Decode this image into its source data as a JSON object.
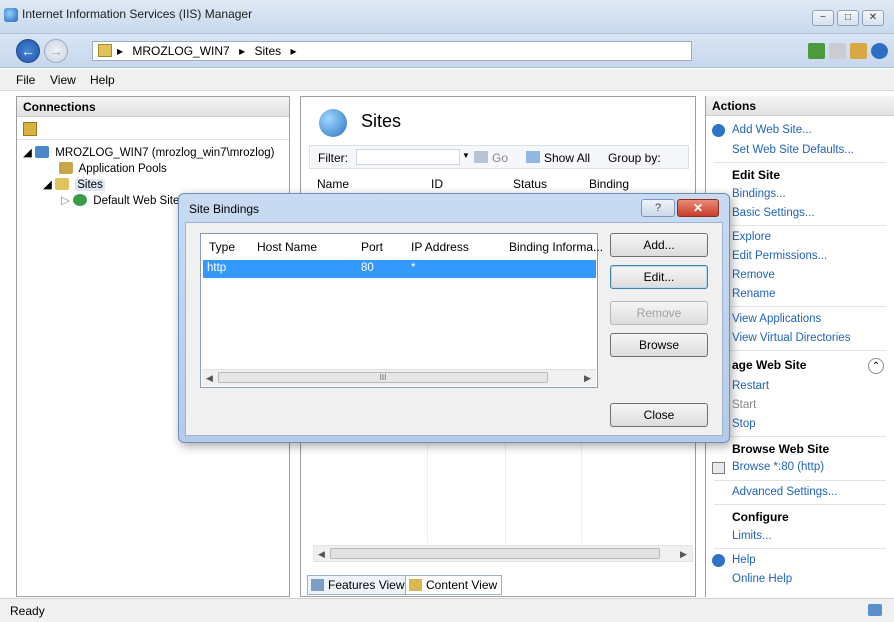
{
  "window": {
    "title": "Internet Information Services (IIS) Manager",
    "minimize": "−",
    "maximize": "□",
    "close": "✕"
  },
  "address": {
    "crumbs": [
      "MROZLOG_WIN7",
      "Sites"
    ],
    "separator": "▸"
  },
  "menu": [
    "File",
    "View",
    "Help"
  ],
  "connections": {
    "header": "Connections",
    "tree": [
      {
        "label": "MROZLOG_WIN7 (mrozlog_win7\\mrozlog)",
        "level": 0,
        "icon": "server-icon"
      },
      {
        "label": "Application Pools",
        "level": 1,
        "icon": "app-pools-icon"
      },
      {
        "label": "Sites",
        "level": 1,
        "icon": "sites-folder-icon"
      },
      {
        "label": "Default Web Site",
        "level": 2,
        "icon": "globe-icon"
      }
    ]
  },
  "center": {
    "title": "Sites",
    "filter_label": "Filter:",
    "go_label": "Go",
    "show_all_label": "Show All",
    "group_by_label": "Group by:",
    "columns": [
      "Name",
      "ID",
      "Status",
      "Binding"
    ],
    "tabs": [
      "Features View",
      "Content View"
    ]
  },
  "actions": {
    "header": "Actions",
    "add_web_site": "Add Web Site...",
    "set_defaults": "Set Web Site Defaults...",
    "edit_site_header": "Edit Site",
    "bindings": "Bindings...",
    "basic_settings": "Basic Settings...",
    "explore": "Explore",
    "edit_permissions": "Edit Permissions...",
    "remove": "Remove",
    "rename": "Rename",
    "view_applications": "View Applications",
    "view_virtual_directories": "View Virtual Directories",
    "manage_header": "age Web Site",
    "restart": "Restart",
    "start": "Start",
    "stop": "Stop",
    "browse_header": "Browse Web Site",
    "browse_http": "Browse *:80 (http)",
    "advanced_settings": "Advanced Settings...",
    "configure_header": "Configure",
    "limits": "Limits...",
    "help": "Help",
    "online_help": "Online Help",
    "collapse_symbol": "⌃"
  },
  "status": {
    "text": "Ready"
  },
  "dialog": {
    "title": "Site Bindings",
    "help_symbol": "?",
    "close_symbol": "✕",
    "columns": [
      "Type",
      "Host Name",
      "Port",
      "IP Address",
      "Binding Informa..."
    ],
    "rows": [
      {
        "type": "http",
        "host": "",
        "port": "80",
        "ip": "*",
        "info": ""
      }
    ],
    "buttons": {
      "add": "Add...",
      "edit": "Edit...",
      "remove": "Remove",
      "browse": "Browse",
      "close": "Close"
    },
    "scroll_thumb": "III"
  }
}
